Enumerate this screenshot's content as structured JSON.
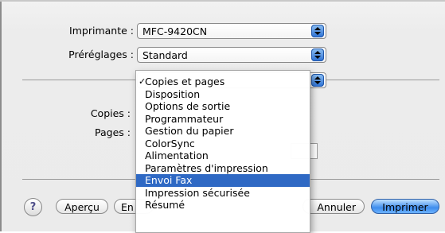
{
  "printer": {
    "label": "Imprimante :",
    "value": "MFC-9420CN"
  },
  "presets": {
    "label": "Préréglages :",
    "value": "Standard"
  },
  "form": {
    "copies_label": "Copies :",
    "pages_label": "Pages :"
  },
  "menu": {
    "items": [
      {
        "label": "Copies et pages",
        "checked": true
      },
      {
        "label": "Disposition"
      },
      {
        "label": "Options de sortie"
      },
      {
        "label": "Programmateur"
      },
      {
        "label": "Gestion du papier"
      },
      {
        "label": "ColorSync"
      },
      {
        "label": "Alimentation"
      },
      {
        "label": "Paramètres d'impression"
      },
      {
        "label": "Envoi Fax",
        "highlighted": true
      },
      {
        "label": "Impression sécurisée"
      },
      {
        "label": "Résumé"
      }
    ]
  },
  "buttons": {
    "help": "?",
    "preview": "Aperçu",
    "pdf_partial": "En",
    "cancel": "Annuler",
    "print": "Imprimer"
  },
  "icons": {
    "check": "check-icon",
    "help": "help-icon",
    "stepper": "popup-stepper-icon"
  },
  "colors": {
    "selection": "#2f69c4",
    "default_button": "#3e8ded"
  }
}
